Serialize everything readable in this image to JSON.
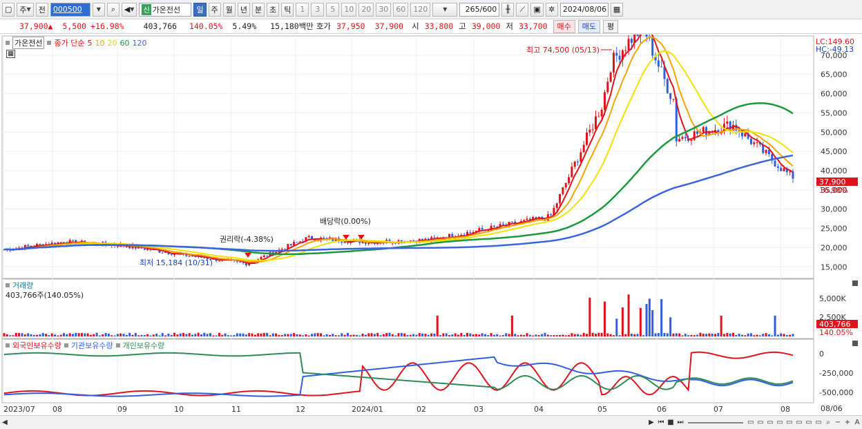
{
  "toolbar": {
    "period_unit": "주",
    "prev_label": "전",
    "code": "000500",
    "new_badge": "신",
    "stock_name": "가온전선",
    "periods": [
      "일",
      "주",
      "월",
      "년",
      "분",
      "초",
      "틱"
    ],
    "active_period": "일",
    "intervals": [
      "1",
      "3",
      "5",
      "10",
      "20",
      "30",
      "60",
      "120"
    ],
    "count": "265",
    "count_total": "600",
    "date": "2024/08/06"
  },
  "quote": {
    "price": "37,900",
    "change_arrow": "▲",
    "change": "5,500",
    "change_pct": "+16.98%",
    "volume": "403,766",
    "volume_ratio": "140.05%",
    "turnover_rate": "5.49%",
    "trade_amount": "15,180백만",
    "ask_label": "호가",
    "ask": "37,950",
    "bid": "37,900",
    "open_label": "시",
    "open": "33,800",
    "high_label": "고",
    "high": "39,000",
    "low_label": "저",
    "low": "33,700",
    "buy_button": "매수",
    "sell_button": "매도",
    "eval_button": "평"
  },
  "price_pane": {
    "stock_tag": "가온전선",
    "ma_label": "종가 단순",
    "ma_periods": [
      "5",
      "10",
      "20",
      "60",
      "120"
    ],
    "ma_colors": [
      "#e0121b",
      "#f5a300",
      "#f2e200",
      "#1a9a3a",
      "#3a64e0"
    ],
    "lc": "LC:149.60",
    "hc": "HC:-49.13",
    "current_price_tag": "37,900",
    "current_pct_tag": "16.98%",
    "annotations": {
      "high": "최고 74,500 (05/13)",
      "low": "최저 15,184 (10/31)",
      "rights": "권리락(-4.38%)",
      "dividend": "배당락(0.00%)"
    }
  },
  "volume_pane": {
    "title": "거래량",
    "value": "403,766주(140.05%)",
    "tag_value": "403,766",
    "tag_pct": "140.05%",
    "axis_labels": [
      "5,000K",
      "2,500K"
    ]
  },
  "holdings_pane": {
    "series": [
      "외국인보유수량",
      "기관보유수량",
      "개인보유수량"
    ],
    "series_colors": [
      "#e0121b",
      "#2f5fe0",
      "#2e8b57"
    ],
    "axis_labels": [
      "0",
      "-250,000",
      "-500,000"
    ]
  },
  "x_axis": {
    "labels": [
      "2023/07",
      "08",
      "09",
      "10",
      "11",
      "12",
      "2024/01",
      "02",
      "03",
      "04",
      "05",
      "06",
      "07",
      "08"
    ],
    "end_label": "08/06"
  },
  "chart_data": {
    "type": "line",
    "title": "가온전선",
    "y_axis_labels": [
      "70,000",
      "65,000",
      "60,000",
      "55,000",
      "50,000",
      "45,000",
      "40,000",
      "35,000",
      "30,000",
      "25,000",
      "20,000",
      "15,000"
    ],
    "ylim": [
      12000,
      75000
    ],
    "x": [
      "2023/07",
      "08",
      "09",
      "10",
      "11",
      "12",
      "2024/01",
      "02",
      "03",
      "04",
      "05",
      "06",
      "07",
      "08"
    ],
    "series": [
      {
        "name": "종가",
        "values": [
          19500,
          21500,
          20500,
          18000,
          15800,
          22500,
          21500,
          22000,
          25000,
          28000,
          62000,
          48000,
          52000,
          38000
        ]
      },
      {
        "name": "120",
        "values": [
          17000,
          17500,
          18000,
          18200,
          18500,
          19000,
          19800,
          20500,
          21500,
          23000,
          31000,
          36000,
          40000,
          41500
        ]
      }
    ]
  }
}
